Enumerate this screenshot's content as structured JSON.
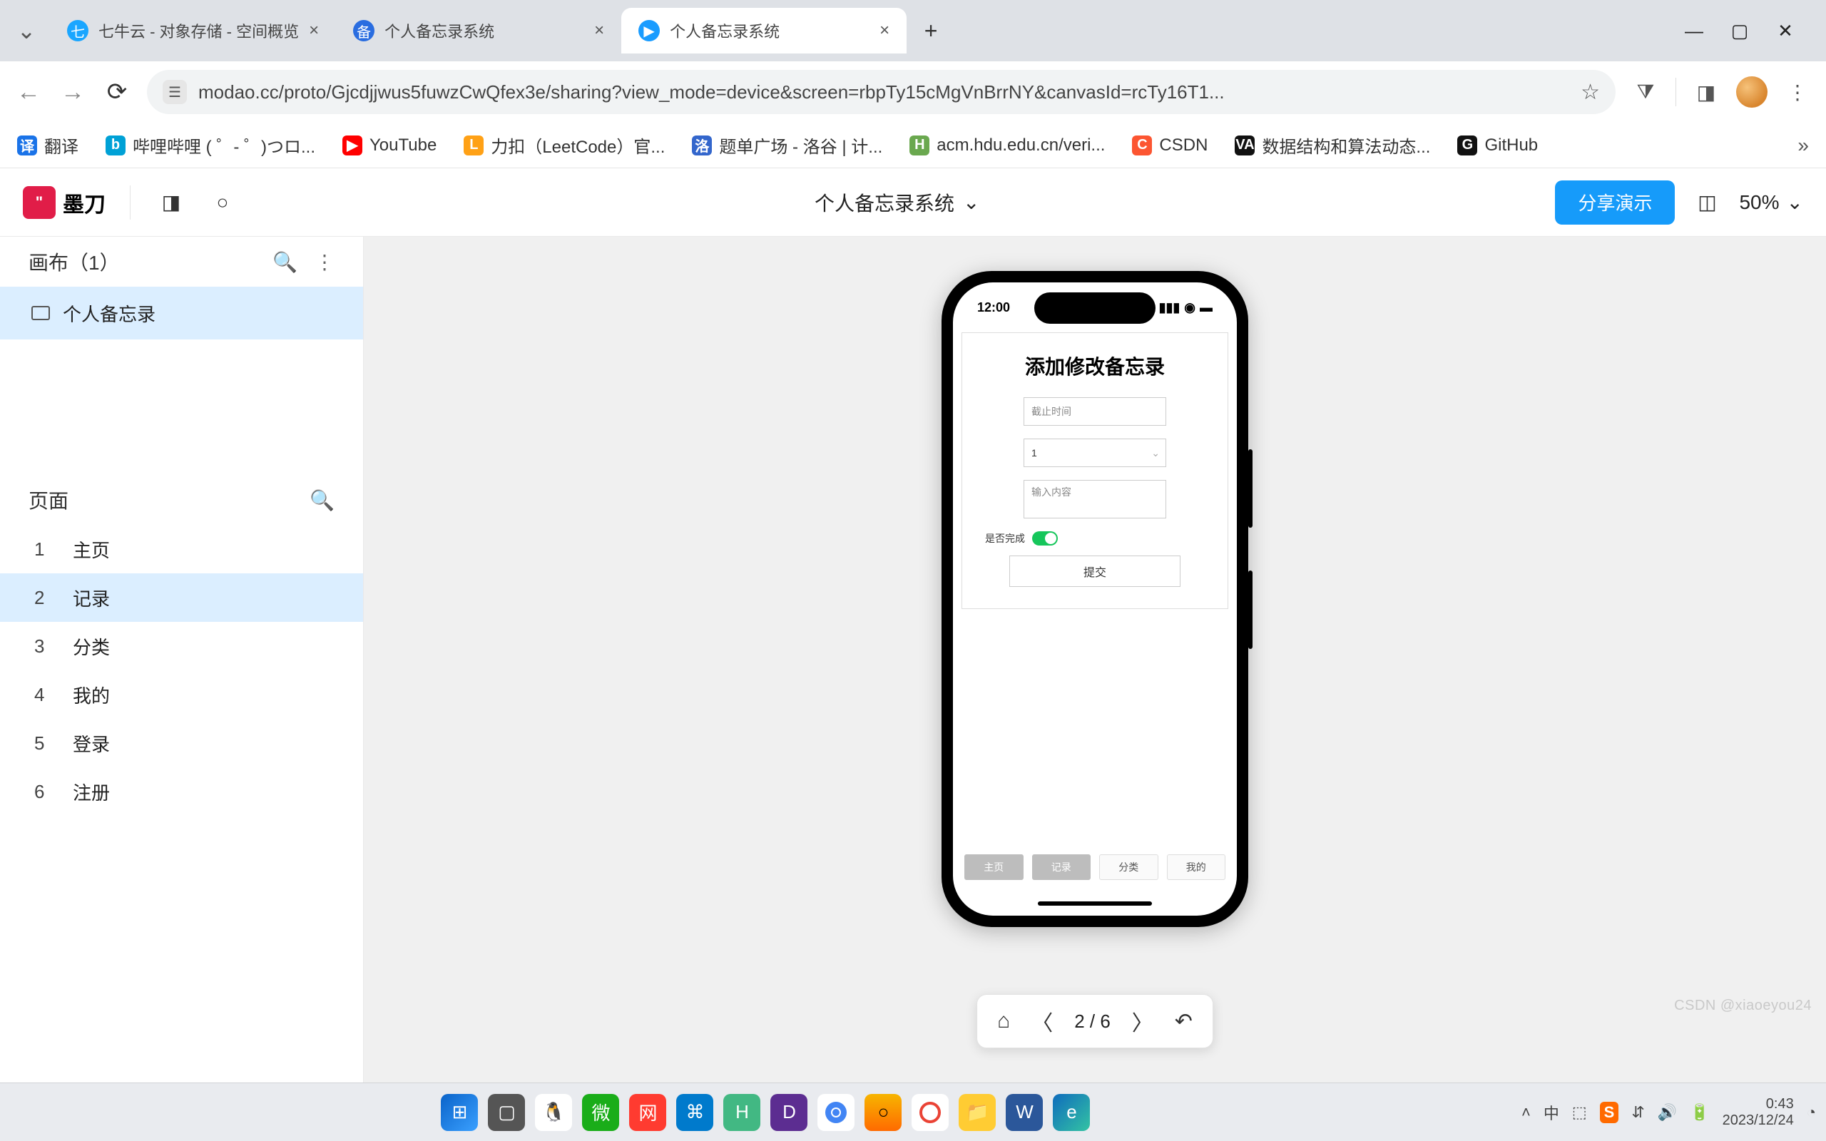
{
  "browser": {
    "tabs": [
      {
        "title": "七牛云 - 对象存储 - 空间概览",
        "favicon_bg": "#1aa6ff",
        "active": false
      },
      {
        "title": "个人备忘录系统",
        "favicon_bg": "#2a6de0",
        "active": false
      },
      {
        "title": "个人备忘录系统",
        "favicon_bg": "#1a9cff",
        "active": true
      }
    ],
    "url": "modao.cc/proto/Gjcdjjwus5fuwzCwQfex3e/sharing?view_mode=device&screen=rbpTy15cMgVnBrrNY&canvasId=rcTy16T1...",
    "bookmarks": [
      {
        "label": "翻译",
        "ic_bg": "#1a73e8",
        "ic_txt": "译"
      },
      {
        "label": "哔哩哔哩 (  ゜- ゜)つロ...",
        "ic_bg": "#00a1d6",
        "ic_txt": "b"
      },
      {
        "label": "YouTube",
        "ic_bg": "#ff0000",
        "ic_txt": "▶"
      },
      {
        "label": "力扣（LeetCode）官...",
        "ic_bg": "#ffa116",
        "ic_txt": "L"
      },
      {
        "label": "题单广场 - 洛谷 | 计...",
        "ic_bg": "#3366cc",
        "ic_txt": "洛"
      },
      {
        "label": "acm.hdu.edu.cn/veri...",
        "ic_bg": "#6aa84f",
        "ic_txt": "H"
      },
      {
        "label": "CSDN",
        "ic_bg": "#fc5531",
        "ic_txt": "C"
      },
      {
        "label": "数据结构和算法动态...",
        "ic_bg": "#111111",
        "ic_txt": "VA"
      },
      {
        "label": "GitHub",
        "ic_bg": "#111111",
        "ic_txt": "G"
      }
    ]
  },
  "app": {
    "brand": "墨刀",
    "project_title": "个人备忘录系统",
    "share_label": "分享演示",
    "zoom": "50%",
    "sidebar": {
      "canvas_header": "画布（1）",
      "canvas_items": [
        {
          "label": "个人备忘录"
        }
      ],
      "pages_header": "页面",
      "pages": [
        {
          "n": "1",
          "label": "主页"
        },
        {
          "n": "2",
          "label": "记录"
        },
        {
          "n": "3",
          "label": "分类"
        },
        {
          "n": "4",
          "label": "我的"
        },
        {
          "n": "5",
          "label": "登录"
        },
        {
          "n": "6",
          "label": "注册"
        }
      ],
      "active_page_index": 1
    },
    "pagenav": {
      "current": 2,
      "total": 6,
      "display": "2 / 6"
    }
  },
  "device": {
    "status_time": "12:00",
    "form": {
      "title": "添加修改备忘录",
      "deadline_placeholder": "截止时间",
      "select_value": "1",
      "content_placeholder": "输入内容",
      "toggle_label": "是否完成",
      "toggle_on": true,
      "submit_label": "提交"
    },
    "tabs": [
      {
        "label": "主页",
        "dim": true
      },
      {
        "label": "记录",
        "dim": true
      },
      {
        "label": "分类",
        "dim": false
      },
      {
        "label": "我的",
        "dim": false
      }
    ]
  },
  "system": {
    "time": "0:43",
    "date": "2023/12/24",
    "ime": "中",
    "watermark": "CSDN @xiaoeyou24"
  }
}
